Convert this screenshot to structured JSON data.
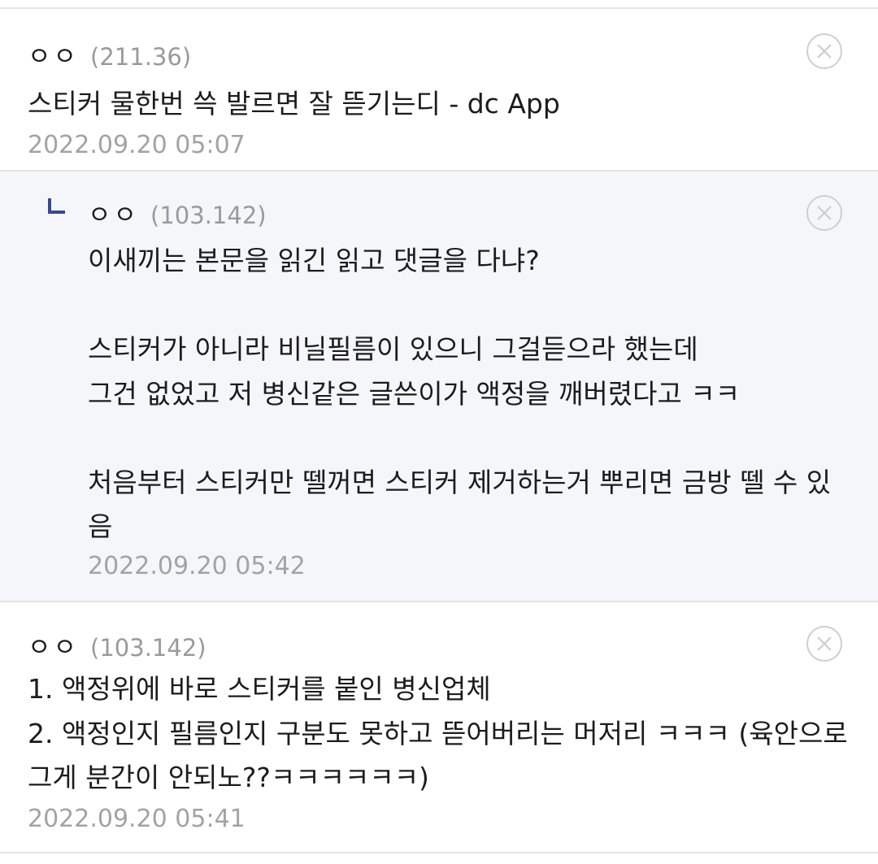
{
  "comments": [
    {
      "nickname": "ㅇㅇ",
      "ip": "(211.36)",
      "text": "스티커 물한번 쓱 발르면 잘 뜯기는디 - dc App",
      "date": "2022.09.20 05:07"
    },
    {
      "nickname": "ㅇㅇ",
      "ip": "(103.142)",
      "text": "이새끼는 본문을 읽긴 읽고 댓글을 다냐?\n\n스티커가 아니라 비닐필름이 있으니 그걸듣으라 했는데\n그건 없었고 저 병신같은 글쓴이가 액정을 깨버렸다고 ㅋㅋ\n\n처음부터 스티커만 뗄꺼면 스티커 제거하는거 뿌리면 금방 뗄 수 있음",
      "date": "2022.09.20 05:42"
    },
    {
      "nickname": "ㅇㅇ",
      "ip": "(103.142)",
      "text": "1. 액정위에 바로 스티커를 붙인 병신업체\n2. 액정인지 필름인지 구분도 못하고 뜯어버리는 머저리 ㅋㅋㅋ (육안으로 그게 분간이 안되노??ㅋㅋㅋㅋㅋㅋ)",
      "date": "2022.09.20 05:41"
    }
  ],
  "icons": {
    "delete": "close-circle-icon",
    "reply": "reply-arrow-icon"
  },
  "colors": {
    "reply_background": "#f5f6fa",
    "reply_arrow": "#3b4890",
    "meta_gray": "#9a9a9a"
  }
}
